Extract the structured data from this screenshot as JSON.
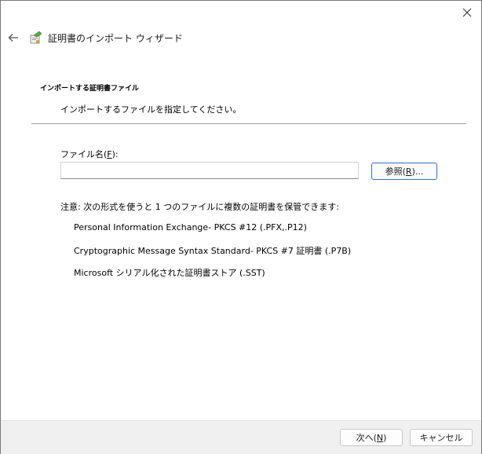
{
  "header": {
    "title": "証明書のインポート ウィザード"
  },
  "page": {
    "section_title": "インポートする証明書ファイル",
    "section_desc": "インポートするファイルを指定してください。"
  },
  "file": {
    "label_prefix": "ファイル名(",
    "label_key": "F",
    "label_suffix": "):",
    "value": "",
    "browse_prefix": "参照(",
    "browse_key": "R",
    "browse_suffix": ")..."
  },
  "note": "注意: 次の形式を使うと 1 つのファイルに複数の証明書を保管できます:",
  "formats": [
    "Personal Information Exchange- PKCS #12 (.PFX,.P12)",
    "Cryptographic Message Syntax Standard- PKCS #7 証明書 (.P7B)",
    "Microsoft シリアル化された証明書ストア (.SST)"
  ],
  "footer": {
    "next_prefix": "次へ(",
    "next_key": "N",
    "next_suffix": ")",
    "cancel_label": "キャンセル"
  },
  "icons": {
    "close": "close-icon",
    "back": "back-arrow-icon",
    "wizard": "certificate-wizard-icon"
  }
}
